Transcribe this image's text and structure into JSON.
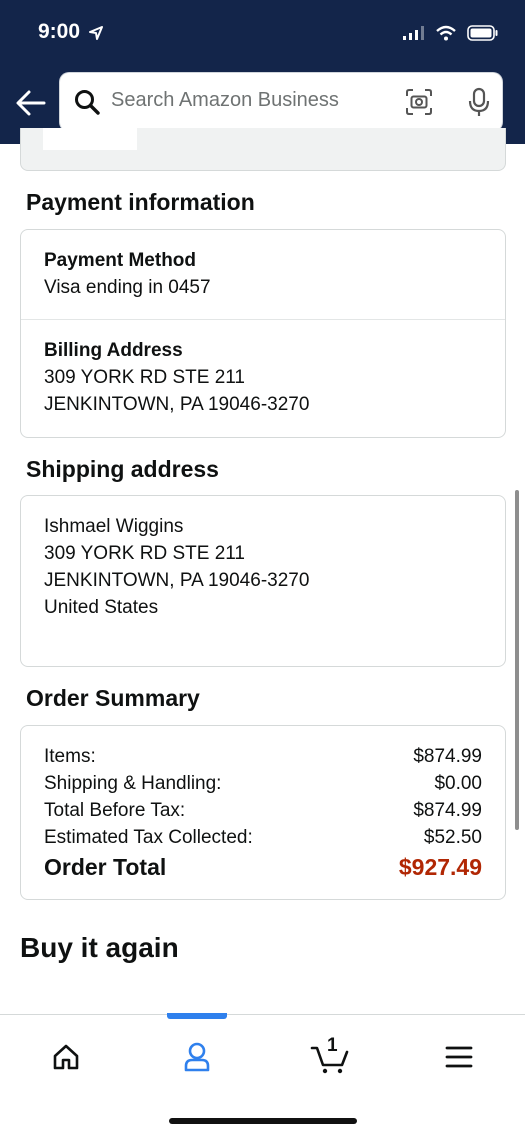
{
  "status_bar": {
    "time": "9:00"
  },
  "search": {
    "placeholder": "Search Amazon Business"
  },
  "payment": {
    "heading": "Payment information",
    "method_title": "Payment Method",
    "method_value": "Visa ending in 0457",
    "billing_title": "Billing Address",
    "billing_lines": [
      "309 YORK RD STE 211",
      "JENKINTOWN, PA 19046-3270"
    ]
  },
  "shipping": {
    "heading": "Shipping address",
    "lines": [
      "Ishmael Wiggins",
      "309 YORK RD STE 211",
      "JENKINTOWN, PA 19046-3270",
      "United States"
    ]
  },
  "summary": {
    "heading": "Order Summary",
    "rows": [
      {
        "label": "Items:",
        "value": "$874.99"
      },
      {
        "label": "Shipping & Handling:",
        "value": "$0.00"
      },
      {
        "label": "Total Before Tax:",
        "value": "$874.99"
      },
      {
        "label": "Estimated Tax Collected:",
        "value": "$52.50"
      }
    ],
    "total_label": "Order Total",
    "total_value": "$927.49"
  },
  "buy_again": {
    "heading": "Buy it again"
  },
  "tabbar": {
    "cart_count": "1"
  },
  "colors": {
    "header_bg": "#13254a",
    "accent_blue": "#2f80ed",
    "total_red": "#b12704"
  },
  "icons": [
    "back-arrow-icon",
    "search-icon",
    "camera-icon",
    "mic-icon",
    "home-icon",
    "account-icon",
    "cart-icon",
    "menu-icon"
  ]
}
